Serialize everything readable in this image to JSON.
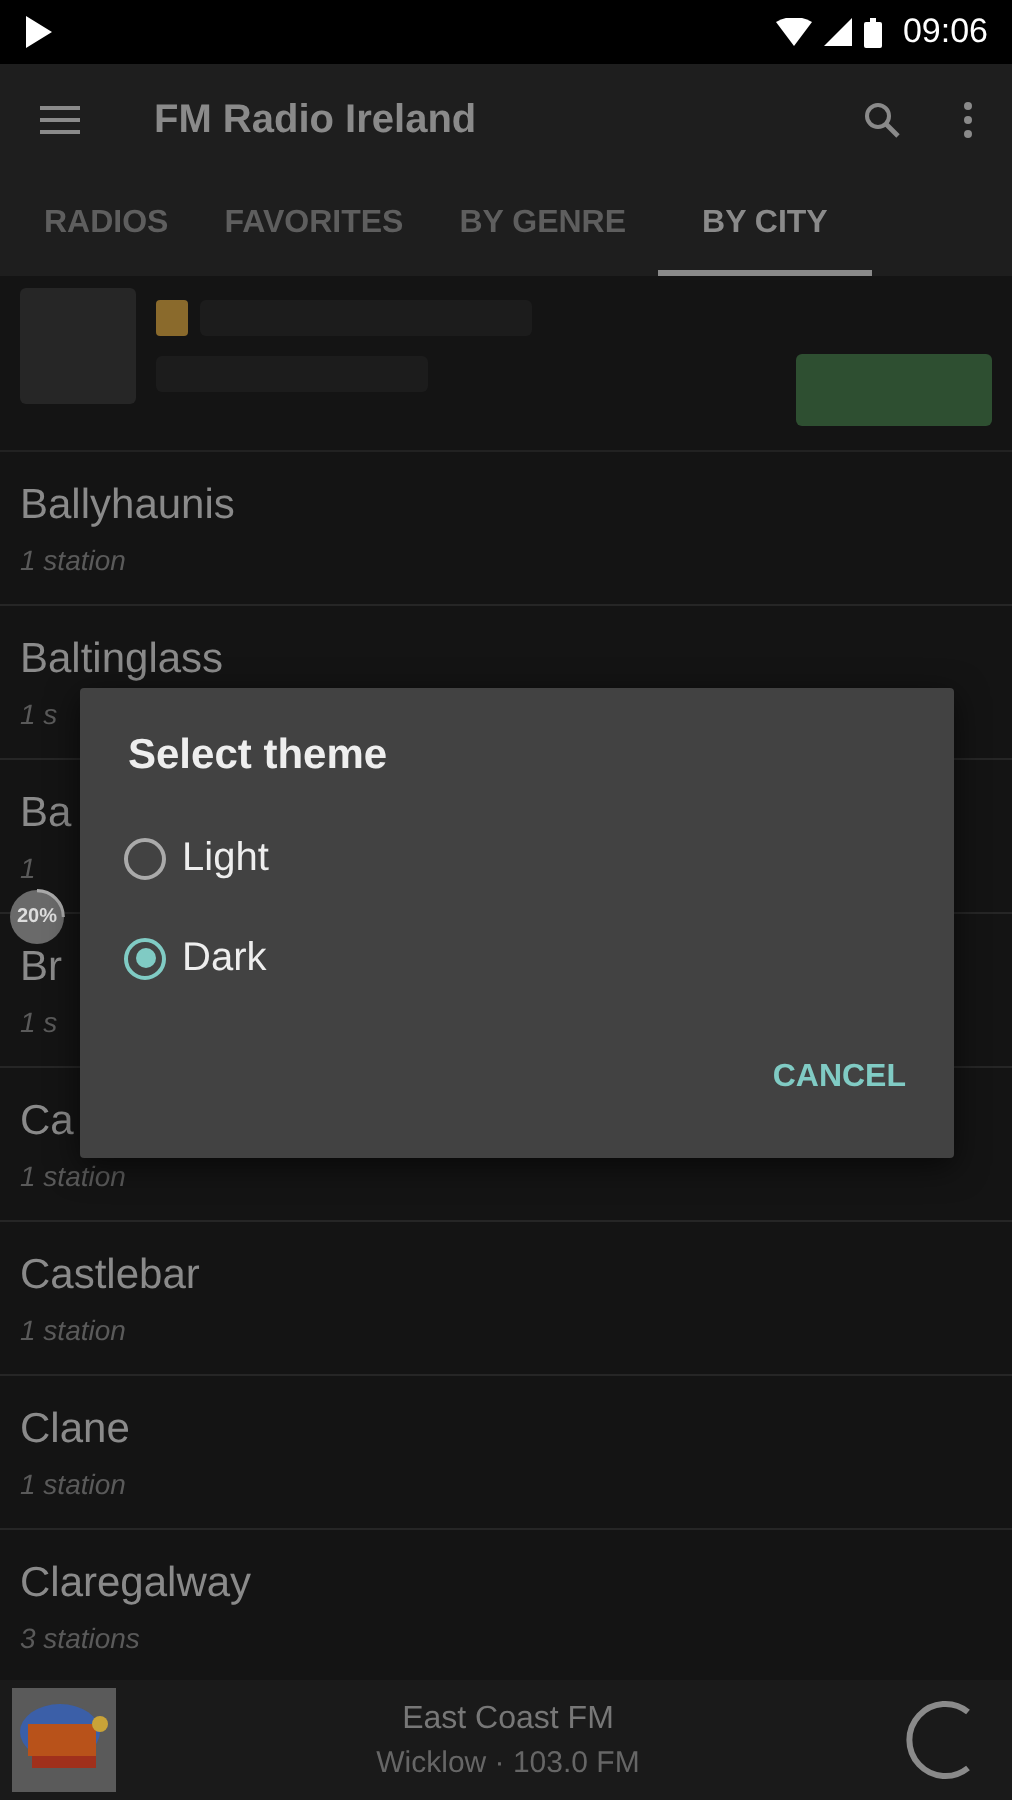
{
  "status_bar": {
    "time": "09:06"
  },
  "toolbar": {
    "title": "FM Radio Ireland"
  },
  "tabs": [
    {
      "label": "RADIOS",
      "selected": false
    },
    {
      "label": "FAVORITES",
      "selected": false
    },
    {
      "label": "BY GENRE",
      "selected": false
    },
    {
      "label": "BY CITY",
      "selected": true
    }
  ],
  "cities": [
    {
      "name": "Ballyhaunis",
      "count": "1 station"
    },
    {
      "name": "Baltinglass",
      "count": "1 s"
    },
    {
      "name": "Ba",
      "count": "1"
    },
    {
      "name": "Br",
      "count": "1 s"
    },
    {
      "name": "Ca",
      "count": "1 station"
    },
    {
      "name": "Castlebar",
      "count": "1 station"
    },
    {
      "name": "Clane",
      "count": "1 station"
    },
    {
      "name": "Claregalway",
      "count": "3 stations"
    }
  ],
  "progress_badge": {
    "label": "20%"
  },
  "player": {
    "station": "East Coast FM",
    "details": "Wicklow · 103.0 FM"
  },
  "dialog": {
    "title": "Select theme",
    "options": [
      {
        "label": "Light",
        "selected": false
      },
      {
        "label": "Dark",
        "selected": true
      }
    ],
    "button": "CANCEL"
  }
}
